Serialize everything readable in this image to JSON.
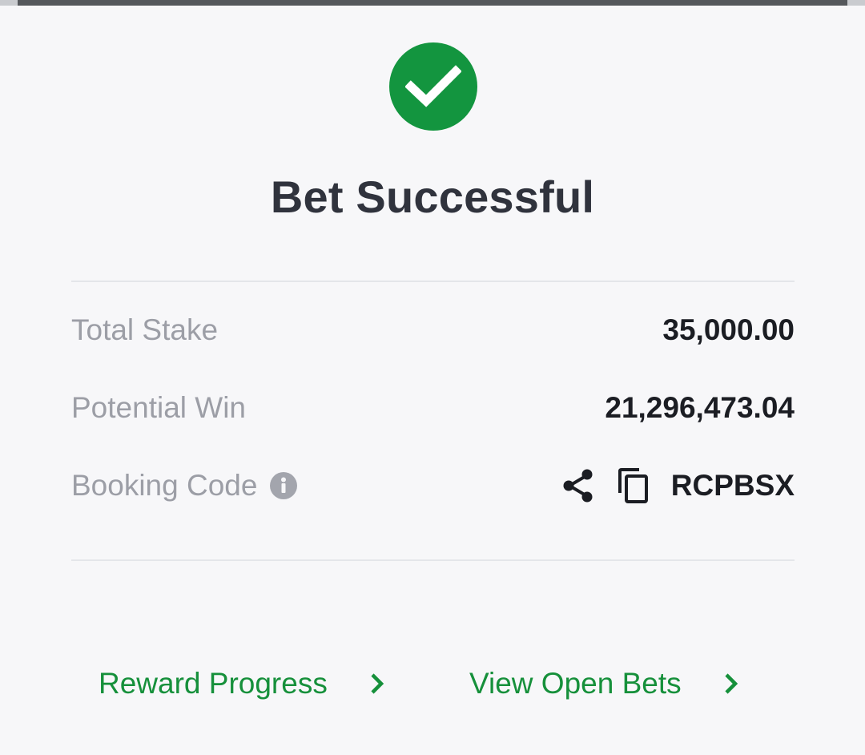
{
  "status": {
    "title": "Bet Successful",
    "icon": "check-circle-icon",
    "accent_color": "#13953f"
  },
  "summary": {
    "rows": [
      {
        "label": "Total Stake",
        "value": "35,000.00"
      },
      {
        "label": "Potential Win",
        "value": "21,296,473.04"
      },
      {
        "label": "Booking Code",
        "value": "RCPBSX"
      }
    ],
    "info_icon": "info-icon",
    "share_icon": "share-icon",
    "copy_icon": "copy-icon"
  },
  "links": {
    "reward_progress": "Reward Progress",
    "view_open_bets": "View Open Bets",
    "chevron_icon": "chevron-right-icon",
    "link_color": "#16903b"
  }
}
